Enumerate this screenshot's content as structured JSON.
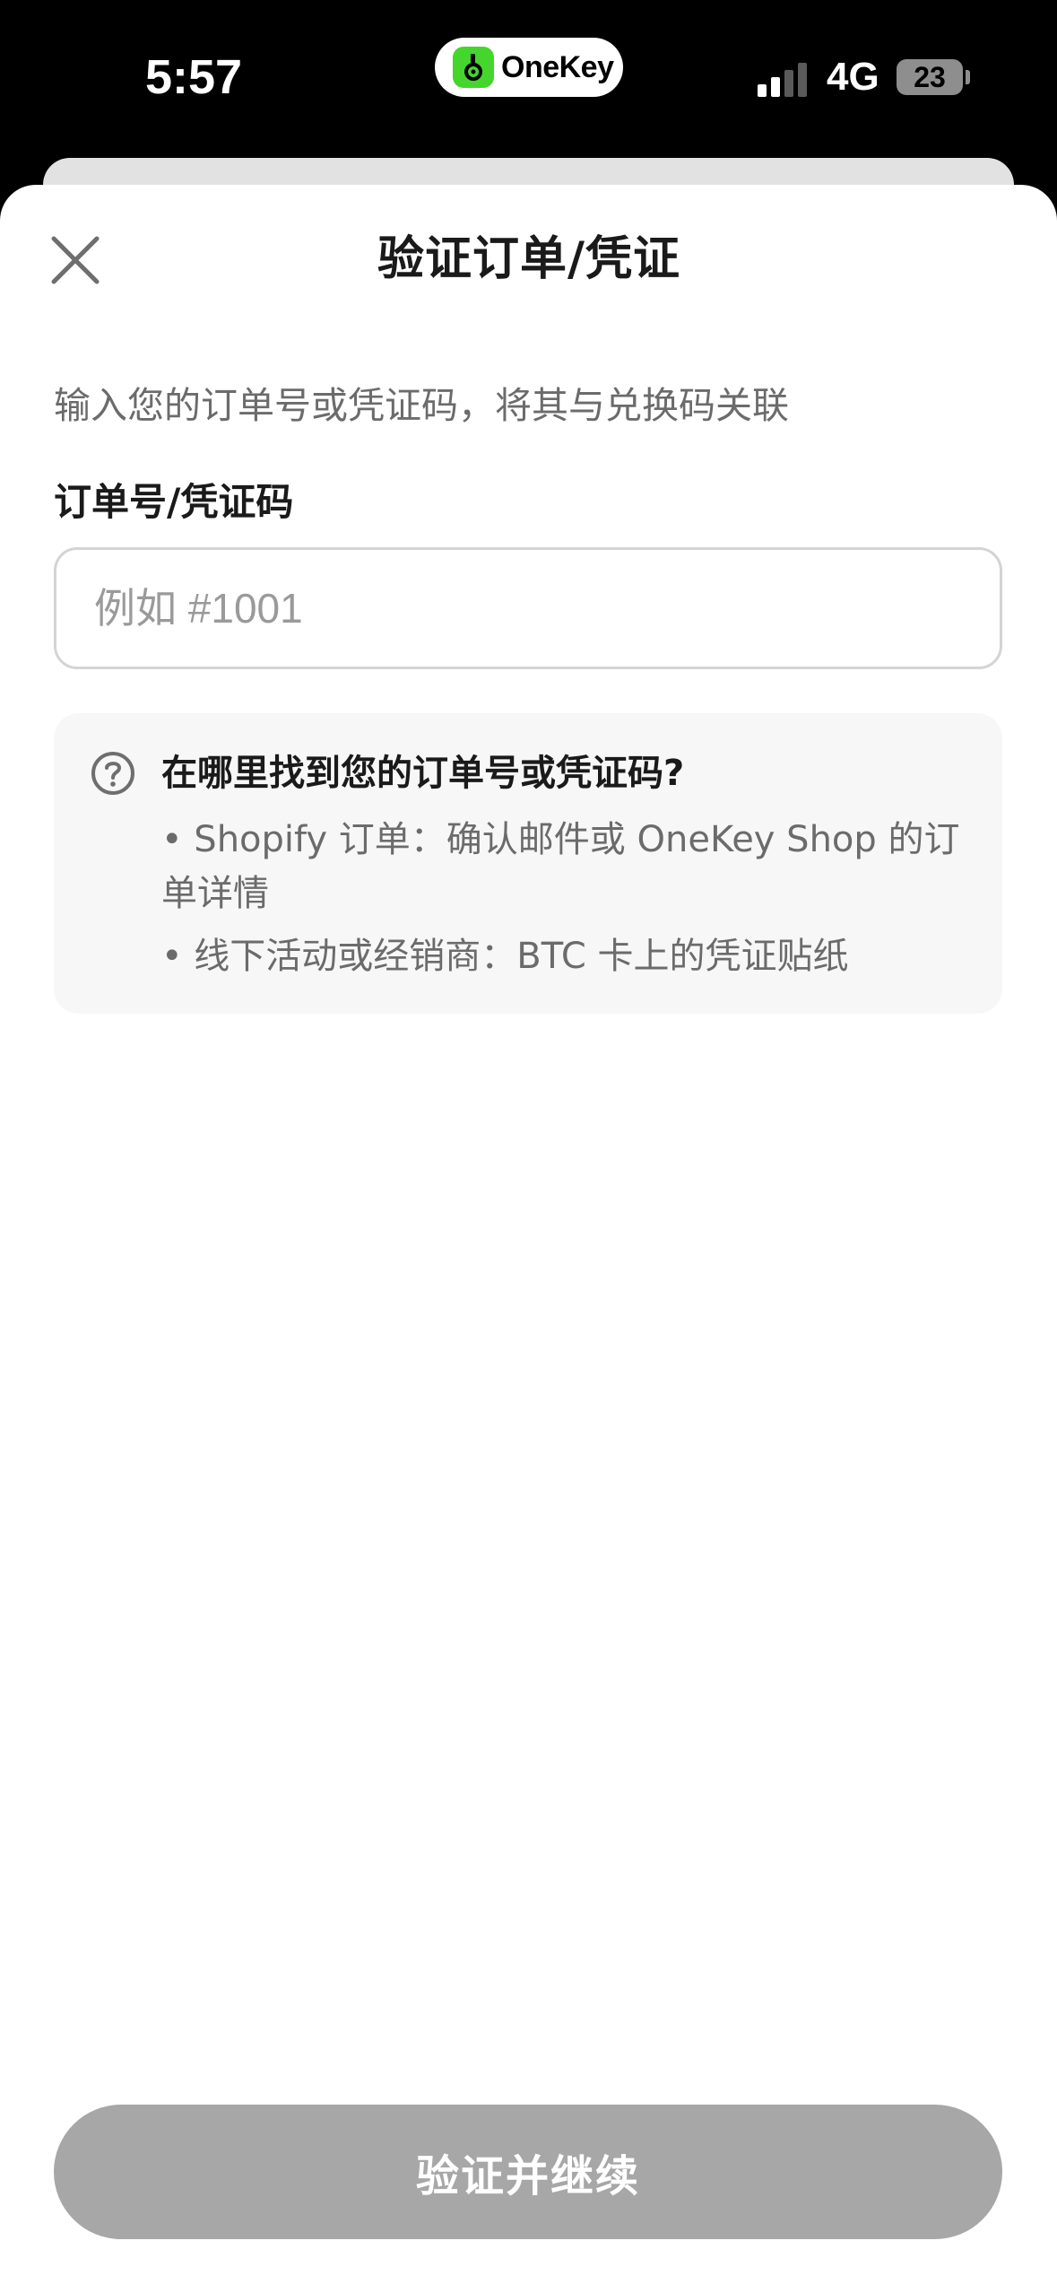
{
  "status_bar": {
    "time": "5:57",
    "island_app": "OneKey",
    "network": "4G",
    "battery": "23"
  },
  "header": {
    "title": "验证订单/凭证"
  },
  "main": {
    "description": "输入您的订单号或凭证码，将其与兑换码关联",
    "field_label": "订单号/凭证码",
    "input_value": "",
    "input_placeholder": "例如 #1001",
    "help": {
      "title": "在哪里找到您的订单号或凭证码?",
      "items": [
        "• Shopify 订单：确认邮件或 OneKey Shop 的订单详情",
        "• 线下活动或经销商：BTC 卡上的凭证贴纸"
      ]
    }
  },
  "footer": {
    "verify_label": "验证并继续"
  },
  "colors": {
    "brand_green": "#44d62c",
    "disabled_button": "#a7a7a7",
    "help_background": "#f7f7f7",
    "text_primary": "#1a1a1a",
    "text_secondary": "#6b6b6b"
  },
  "icons": {
    "close": "close-icon",
    "help": "question-circle-icon",
    "signal": "cellular-signal-icon",
    "battery": "battery-icon",
    "logo": "onekey-logo-icon"
  }
}
